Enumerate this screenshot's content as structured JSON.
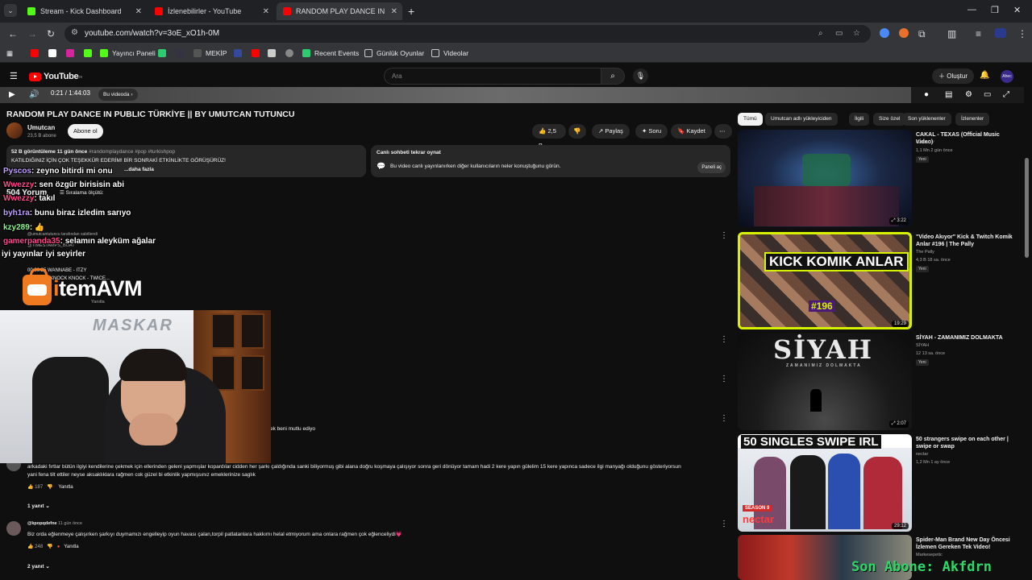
{
  "browser": {
    "tabs": [
      {
        "title": "Stream - Kick Dashboard",
        "color": "#53fc18"
      },
      {
        "title": "İzlenebilirler - YouTube",
        "color": "#ff0000"
      },
      {
        "title": "RANDOM PLAY DANCE IN",
        "color": "#ff0000"
      }
    ],
    "url": "youtube.com/watch?v=3oE_xO1h-0M",
    "bookmarks": [
      "Yayıncı Paneli",
      "MEKİP",
      "Recent Events",
      "Günlük Oyunlar",
      "Videolar"
    ]
  },
  "yt": {
    "logo": "YouTube",
    "logo_sup": "TR",
    "search_placeholder": "Ara",
    "create": "Oluştur",
    "avatar": "Ahec"
  },
  "player": {
    "time": "0:21 / 1:44:03",
    "chapter": "Bu videoda ›"
  },
  "video": {
    "title": "RANDOM PLAY DANCE IN PUBLIC TÜRKİYE || BY UMUTCAN TUTUNCU",
    "channel": "Umutcan",
    "subs": "23,5 B abone",
    "subscribe": "Abone ol",
    "likes": "2,5 B",
    "share": "Paylaş",
    "ask": "Soru",
    "save": "Kaydet"
  },
  "description": {
    "meta": "52 B görüntüleme  11 gün önce",
    "tags": "#randomplaydance #pop #turkishpop",
    "line2": "KATILDIĞINIZ İÇİN ÇOK TEŞEKKÜR EDERİM! BİR SONRAKİ ETKİNLİKTE GÖRÜŞÜRÜZ!",
    "line3": "...daha fazla"
  },
  "livechat": {
    "title": "Canlı sohbeti tekrar oynat",
    "text": "Bu video canlı yayınlanırken diğer kullanıcıların neler konuştuğunu görün.",
    "button": "Paneli aç"
  },
  "comments": {
    "count": "504 Yorum",
    "sort": "Sıralama ölçütü:",
    "pinned_by": "@umutcantutuncu tarafından sabitlendi",
    "pinned_user": "@TIMESTAMPS_BOAT",
    "pinned_lines": [
      "00:00:35 WANNABE - ITZY",
      "KNOCK KNOCK - TWICE..."
    ],
    "reply": "Yanıtla",
    "c1_text": "ek beni mutlu ediyo",
    "c2_text": "arkadaki fırtlar bütün ilgiyi kendilerine çekmek için ellerinden geleni yapmışlar kopardılar cidden her şarkı çaldığında sanki biliyormuş gibi alana doğru koşmaya çalışıyor sonra geri dönüyor tamam hadi 2 kere yapın gülelim 15 kere yapınca sadece ilgi manyağı olduğunu gösteriyorsun",
    "c2_text2": "yani fena tilt ettiler neyse aksaklıklara rağmen cok güzel bi etkinlik yapmışsınız emeklerinize saglık",
    "c2_likes": "187",
    "c2_replies": "1 yanıt",
    "c3_user": "@kpopqdefne",
    "c3_time": "11 gün önce",
    "c3_text": "Biz orda eğlenmeye çalışırken şarkıyı duymamızı engelleyip oyun havası çalan,torpil patlatanlara hakkımı helal etmiyorum ama onlara rağmen çok eğlenceliydi💗",
    "c3_likes": "248",
    "c3_replies": "2 yanıt"
  },
  "overlay": {
    "chat": [
      {
        "user": "Pyscos",
        "msg": ": zeyno bitirdi mi onu"
      },
      {
        "user": "Wwezzy",
        "msg": ": sen özgür birisisin abi"
      },
      {
        "user": "Wwezzy",
        "msg": ": takıl"
      },
      {
        "user": "byh1ra",
        "msg": ": bunu biraz izledim sarıyo"
      },
      {
        "user": "kzy289",
        "msg": ": 👍"
      },
      {
        "user": "gamerpanda35",
        "msg": ": selamın aleyküm ağalar"
      }
    ],
    "line_extra": "iyi yayınlar iyi seyirler",
    "brand": "temAVM",
    "brand_accent": "i",
    "webcam_wm": "MASKAR",
    "son_abone": "Son Abone: Akfdrn"
  },
  "sidebar": {
    "chips": [
      "Tümü",
      "Umutcan adlı yükleyiciden",
      "İlgili",
      "Size özel",
      "Son yüklenenler",
      "İzlenenler"
    ],
    "recs": [
      {
        "title": "CAKAL - TEXAS (Official Music Video)",
        "channel": "CAKAL ✓",
        "views": "1,1 Mn  2 gün önce",
        "badge": "Yeni",
        "dur": "3:22"
      },
      {
        "title": "\"Video Akıyor\" Kick & Twitch Komik Anlar #196 | The Pally",
        "channel": "The Pally",
        "views": "4,3 B  18 sa. önce",
        "badge": "Yeni",
        "dur": "19:29",
        "thumb_text": "KICK KOMIK ANLAR",
        "thumb_num": "#196"
      },
      {
        "title": "SİYAH - ZAMANIMIZ DOLMAKTA",
        "channel": "SİYAH",
        "views": "12  13 sa. önce",
        "badge": "Yeni",
        "dur": "2:07",
        "thumb_text": "SİYAH",
        "thumb_sub": "ZAMANIMIZ DOLMAKTA"
      },
      {
        "title": "50 strangers swipe on each other | swipe or swap",
        "channel": "nectar",
        "views": "1,2 Mn  1 ay önce",
        "badge": "",
        "dur": "29:12",
        "thumb_text": "50 SINGLES SWIPE IRL",
        "thumb_season": "SEASON 9",
        "thumb_brand": "nectar"
      },
      {
        "title": "Spider-Man Brand New Day Öncesi İzlemen Gereken Tek Video!",
        "channel": "Markesepetic",
        "views": "",
        "badge": "",
        "dur": ""
      }
    ]
  }
}
